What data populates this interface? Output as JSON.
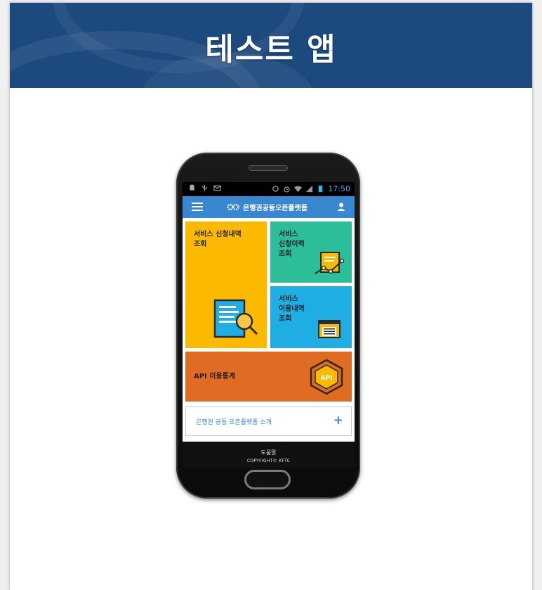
{
  "banner": {
    "title": "테스트 앱",
    "color": "#1d4a7e"
  },
  "statusbar": {
    "time": "17:50",
    "icons": [
      "android-debug-icon",
      "usb-icon",
      "mail-icon",
      "sync-icon",
      "alarm-icon",
      "wifi-icon",
      "signal-icon",
      "battery-icon"
    ]
  },
  "appbar": {
    "title": "은행권공동오픈플랫폼",
    "menu_icon": "hamburger-menu-icon",
    "logo_icon": "gear-logo-icon",
    "user_icon": "user-icon",
    "color": "#3a87d1"
  },
  "tiles": [
    {
      "label": "서비스 신청내역\n조회",
      "color": "#fbb900",
      "icon": "document-search-icon"
    },
    {
      "label": "서비스\n신청이력\n조회",
      "color": "#2cbd9a",
      "icon": "chart-document-icon"
    },
    {
      "label": "서비스\n이용내역\n조회",
      "color": "#1eaee3",
      "icon": "list-window-icon"
    },
    {
      "label": "API 이용통계",
      "color": "#e06b22",
      "icon": "api-hexagon-icon",
      "badge": "API"
    }
  ],
  "intro": {
    "label": "은행권 공동 오픈플랫폼 소개",
    "action": "+"
  },
  "footer": {
    "help": "도움말",
    "copyright": "COPYFIGHT© KFTC"
  }
}
